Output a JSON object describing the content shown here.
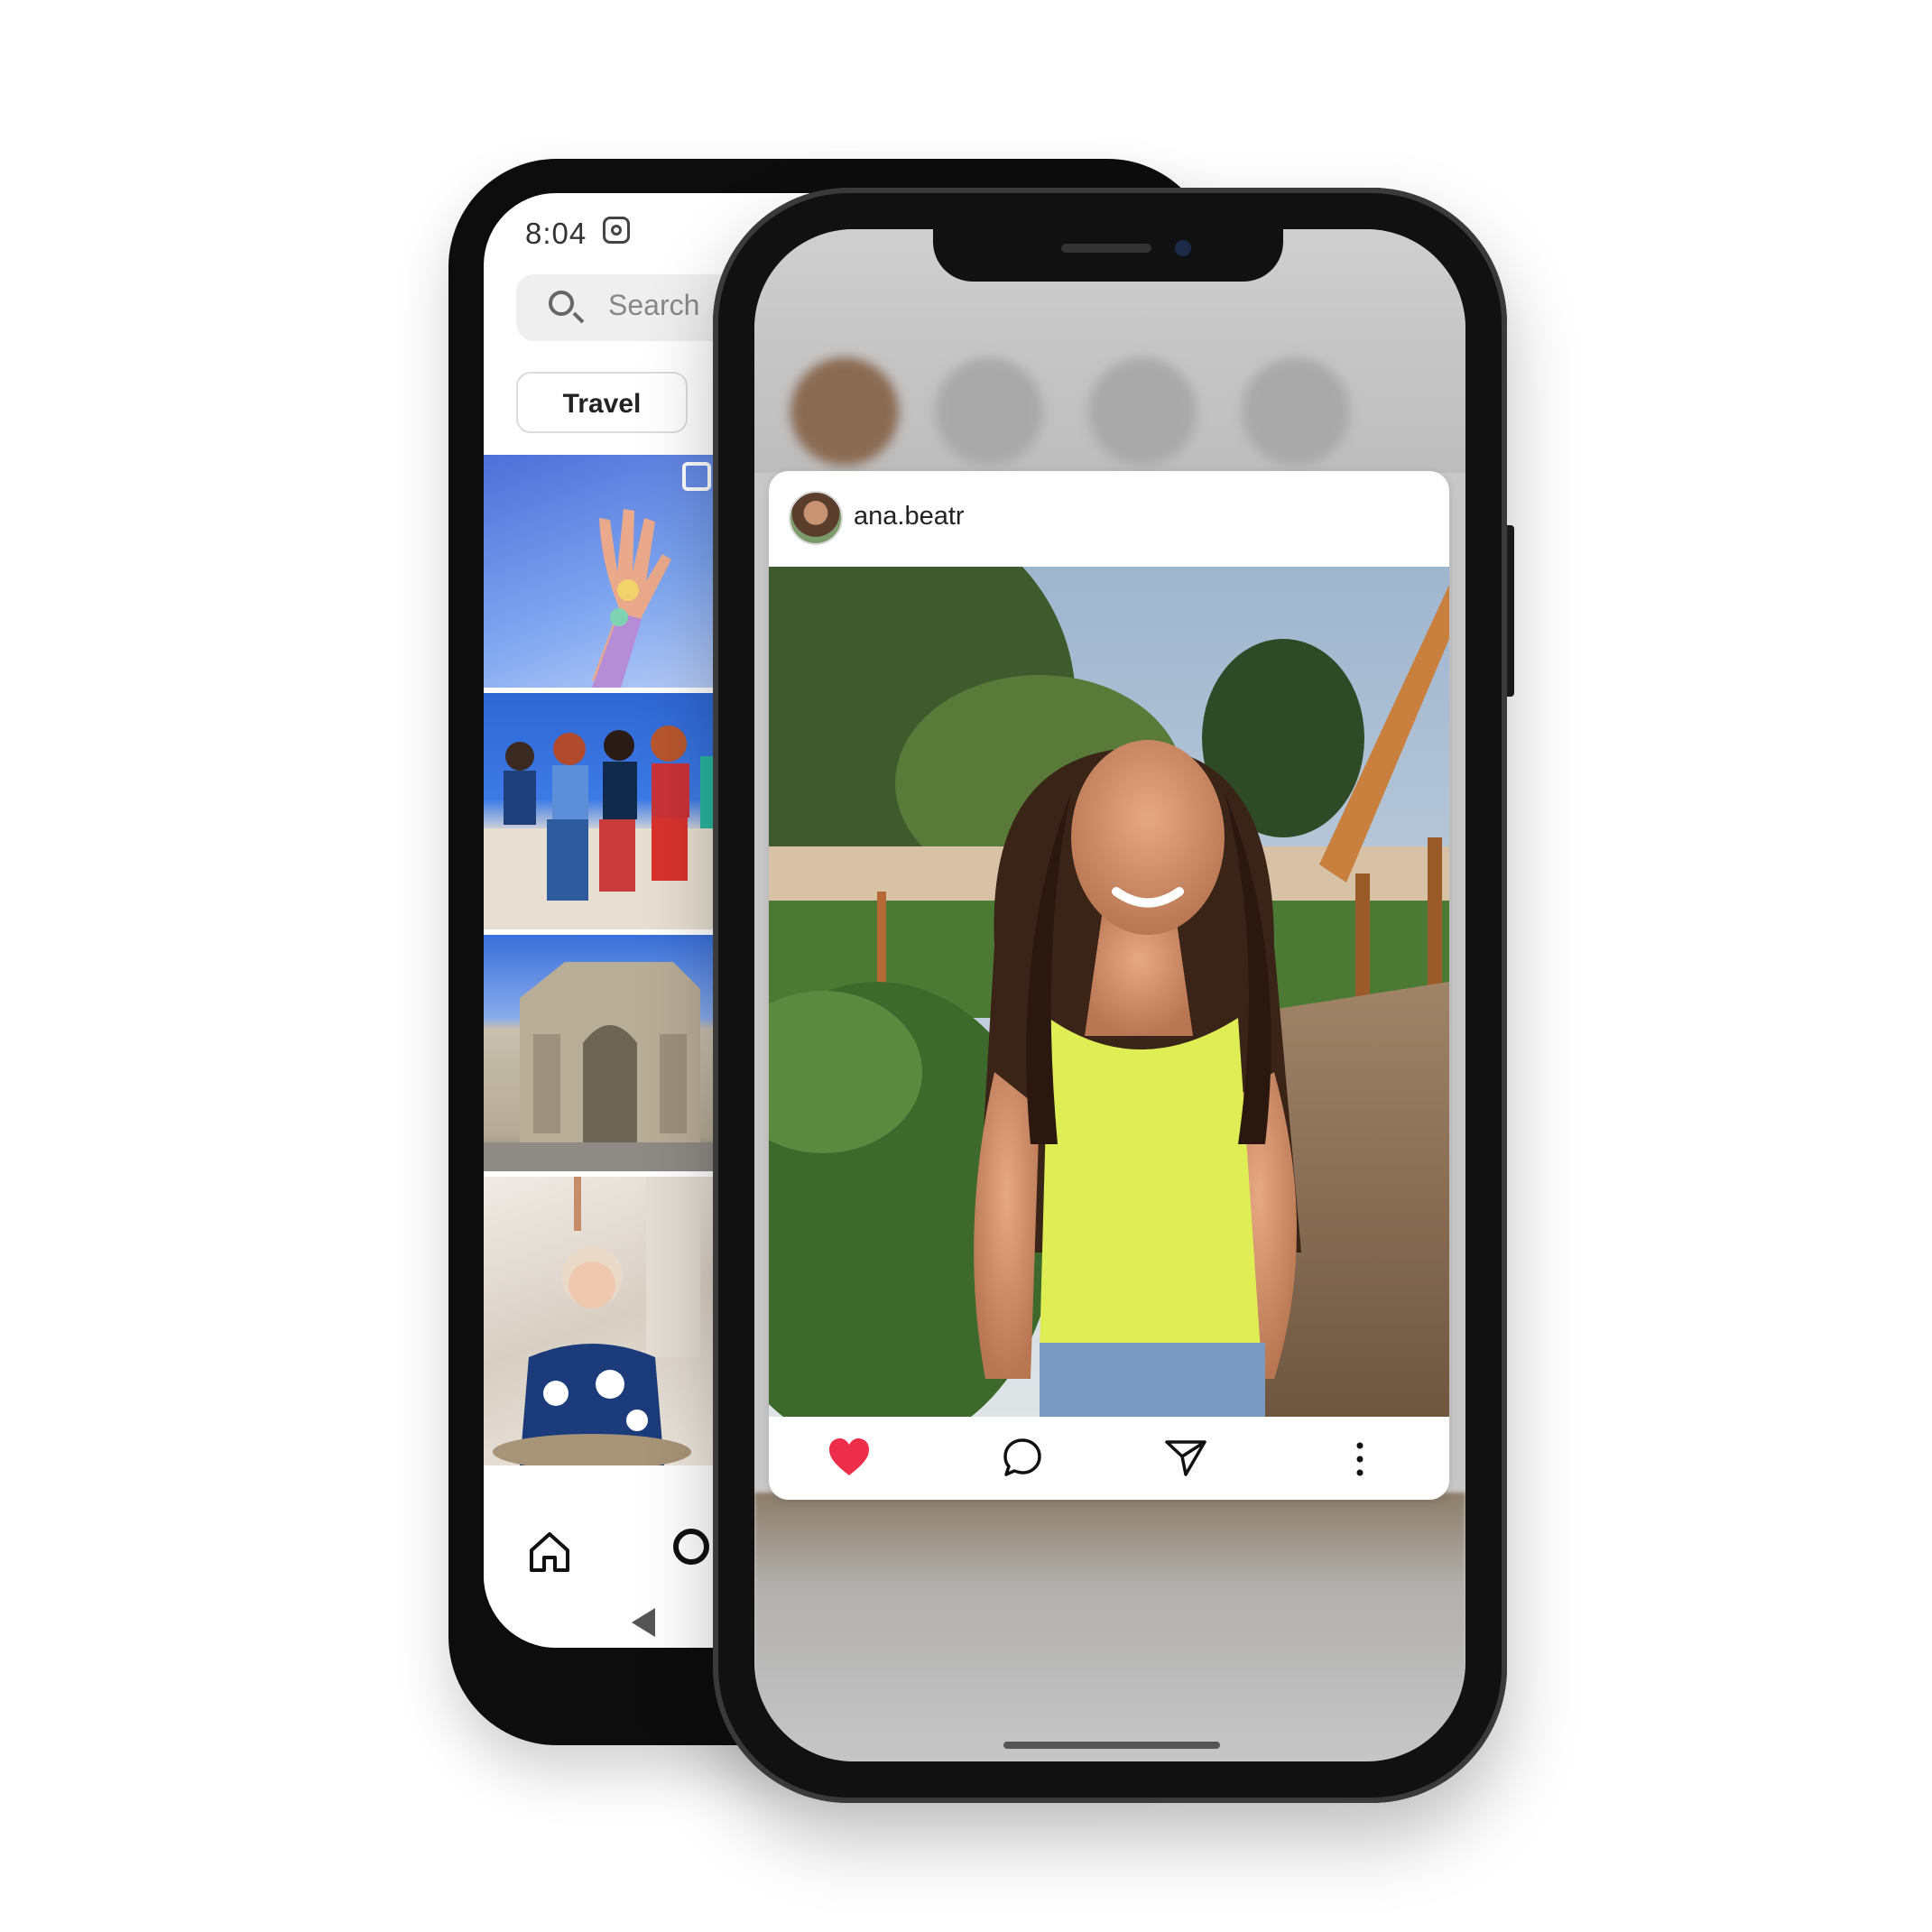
{
  "back_phone": {
    "status_time": "8:04",
    "search_placeholder": "Search",
    "chip_label": "Travel",
    "tiles": [
      "hand-glitter-photo",
      "group-friends-photo",
      "arch-monument-photo",
      "woman-eating-photo"
    ],
    "nav_icons": [
      "home-icon",
      "search-icon",
      "back-triangle-icon"
    ]
  },
  "front_phone": {
    "post": {
      "username": "ana.beatr",
      "image_subject": "woman-yellow-top-garden-photo",
      "actions": [
        "heart-icon",
        "comment-icon",
        "share-icon",
        "more-icon"
      ],
      "liked": true
    }
  },
  "colors": {
    "heart": "#ed2e4b",
    "phone_body": "#111111",
    "chip_border": "#dcdcdc",
    "search_bg": "#efefef"
  }
}
